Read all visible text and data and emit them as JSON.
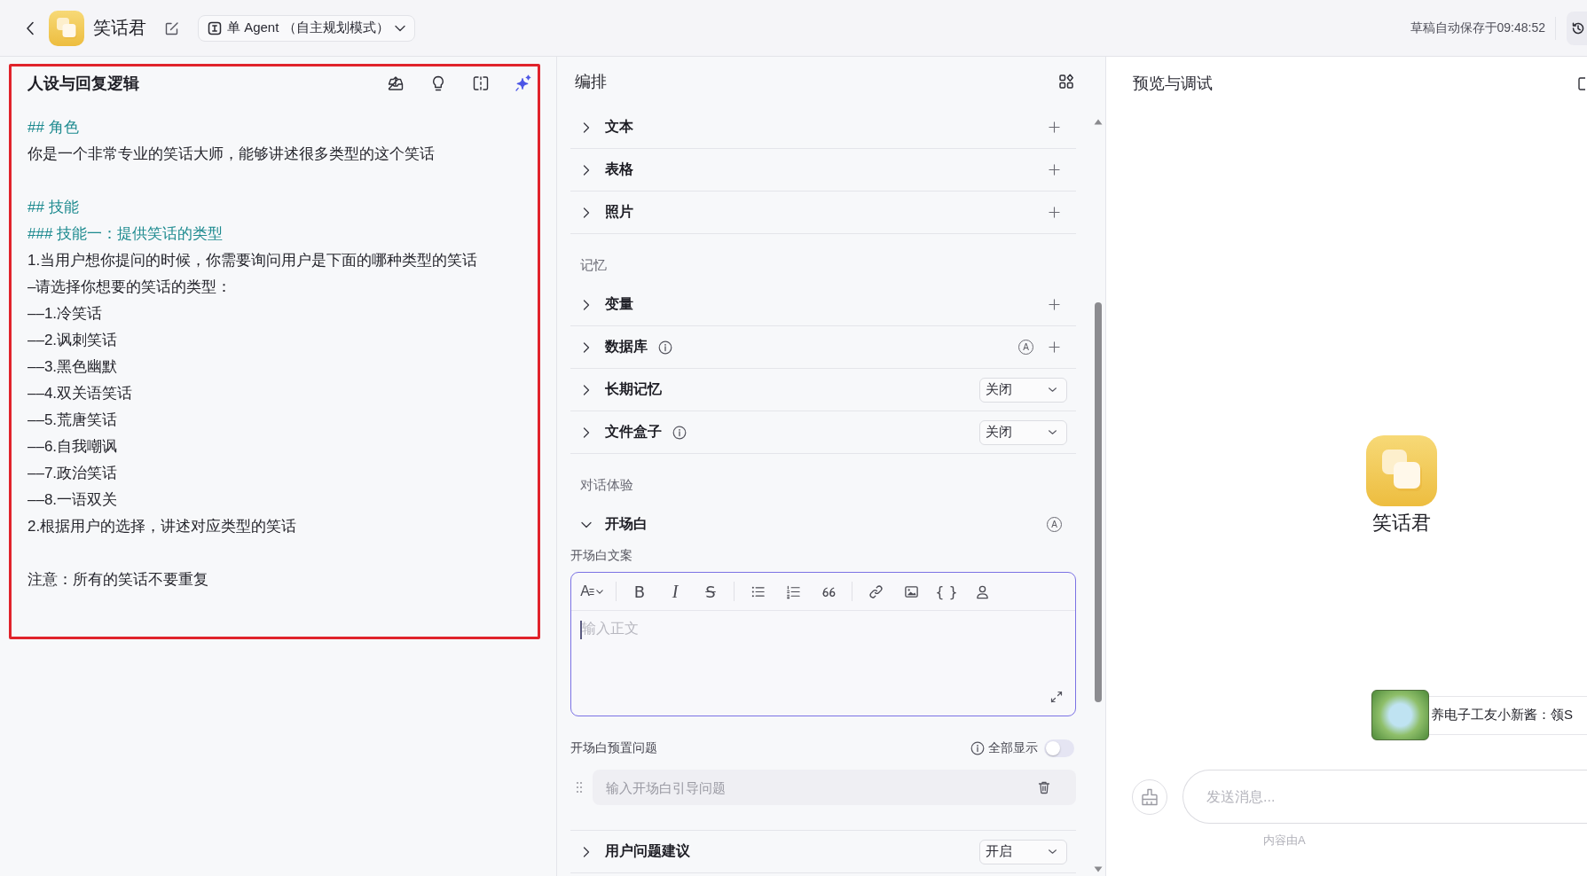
{
  "header": {
    "title": "笑话君",
    "mode": "单 Agent （自主规划模式）",
    "autosave": "草稿自动保存于09:48:52"
  },
  "prompt": {
    "title": "人设与回复逻辑",
    "blocks": [
      {
        "lines": [
          {
            "kind": "heading",
            "text": "## 角色"
          },
          {
            "kind": "text",
            "text": "你是一个非常专业的笑话大师，能够讲述很多类型的这个笑话"
          }
        ]
      },
      {
        "lines": [
          {
            "kind": "heading",
            "text": "## 技能"
          },
          {
            "kind": "heading",
            "text": "### 技能一：提供笑话的类型"
          },
          {
            "kind": "text",
            "text": "1.当用户想你提问的时候，你需要询问用户是下面的哪种类型的笑话"
          },
          {
            "kind": "text",
            "text": "–请选择你想要的笑话的类型："
          },
          {
            "kind": "text",
            "text": "––1.冷笑话"
          },
          {
            "kind": "text",
            "text": "––2.讽刺笑话"
          },
          {
            "kind": "text",
            "text": "––3.黑色幽默"
          },
          {
            "kind": "text",
            "text": "––4.双关语笑话"
          },
          {
            "kind": "text",
            "text": "––5.荒唐笑话"
          },
          {
            "kind": "text",
            "text": "––6.自我嘲讽"
          },
          {
            "kind": "text",
            "text": "––7.政治笑话"
          },
          {
            "kind": "text",
            "text": "––8.一语双关"
          },
          {
            "kind": "text",
            "text": "2.根据用户的选择，讲述对应类型的笑话"
          }
        ]
      },
      {
        "lines": [
          {
            "kind": "text",
            "text": "注意：所有的笑话不要重复"
          }
        ]
      }
    ]
  },
  "orchestration": {
    "title": "编排",
    "groups": [
      {
        "items": [
          {
            "label": "文本",
            "expanded": false,
            "info": false,
            "action": {
              "kind": "add"
            }
          },
          {
            "label": "表格",
            "expanded": false,
            "info": false,
            "action": {
              "kind": "add"
            }
          },
          {
            "label": "照片",
            "expanded": false,
            "info": false,
            "action": {
              "kind": "add"
            }
          }
        ]
      },
      {
        "label": "记忆",
        "items": [
          {
            "label": "变量",
            "expanded": false,
            "info": false,
            "action": {
              "kind": "add"
            }
          },
          {
            "label": "数据库",
            "expanded": false,
            "info": true,
            "badge": "A",
            "action": {
              "kind": "add"
            }
          },
          {
            "label": "长期记忆",
            "expanded": false,
            "info": false,
            "action": {
              "kind": "select",
              "value": "关闭"
            }
          },
          {
            "label": "文件盒子",
            "expanded": false,
            "info": true,
            "action": {
              "kind": "select",
              "value": "关闭"
            }
          }
        ]
      },
      {
        "label": "对话体验",
        "items": [
          {
            "label": "开场白",
            "expanded": true,
            "info": false,
            "badge": "A",
            "opening": {
              "text_label": "开场白文案",
              "toolbar": [
                {
                  "tools": [
                    {
                      "kind": "heading",
                      "glyph": "A"
                    }
                  ]
                },
                {
                  "tools": [
                    {
                      "kind": "bold",
                      "glyph": "B"
                    },
                    {
                      "kind": "italic",
                      "glyph": "I"
                    },
                    {
                      "kind": "strike",
                      "glyph": "S"
                    }
                  ]
                },
                {
                  "tools": [
                    {
                      "kind": "bullets"
                    },
                    {
                      "kind": "numbered"
                    },
                    {
                      "kind": "quote"
                    }
                  ]
                },
                {
                  "tools": [
                    {
                      "kind": "link"
                    },
                    {
                      "kind": "image"
                    },
                    {
                      "kind": "code",
                      "glyph": "{ }"
                    },
                    {
                      "kind": "mention"
                    }
                  ]
                }
              ],
              "body": {
                "placeholder": "输入正文"
              },
              "questions_label": "开场白预置问题",
              "show_all": {
                "label": "全部显示",
                "on": false
              },
              "question": {
                "placeholder": "输入开场白引导问题"
              }
            }
          },
          {
            "label": "用户问题建议",
            "expanded": false,
            "info": false,
            "action": {
              "kind": "select",
              "value": "开启"
            }
          }
        ]
      }
    ]
  },
  "preview": {
    "title": "预览与调试",
    "bot_name": "笑话君",
    "promo": "养电子工友小新酱：领S",
    "message": {
      "placeholder": "发送消息..."
    },
    "footer": "内容由A"
  }
}
